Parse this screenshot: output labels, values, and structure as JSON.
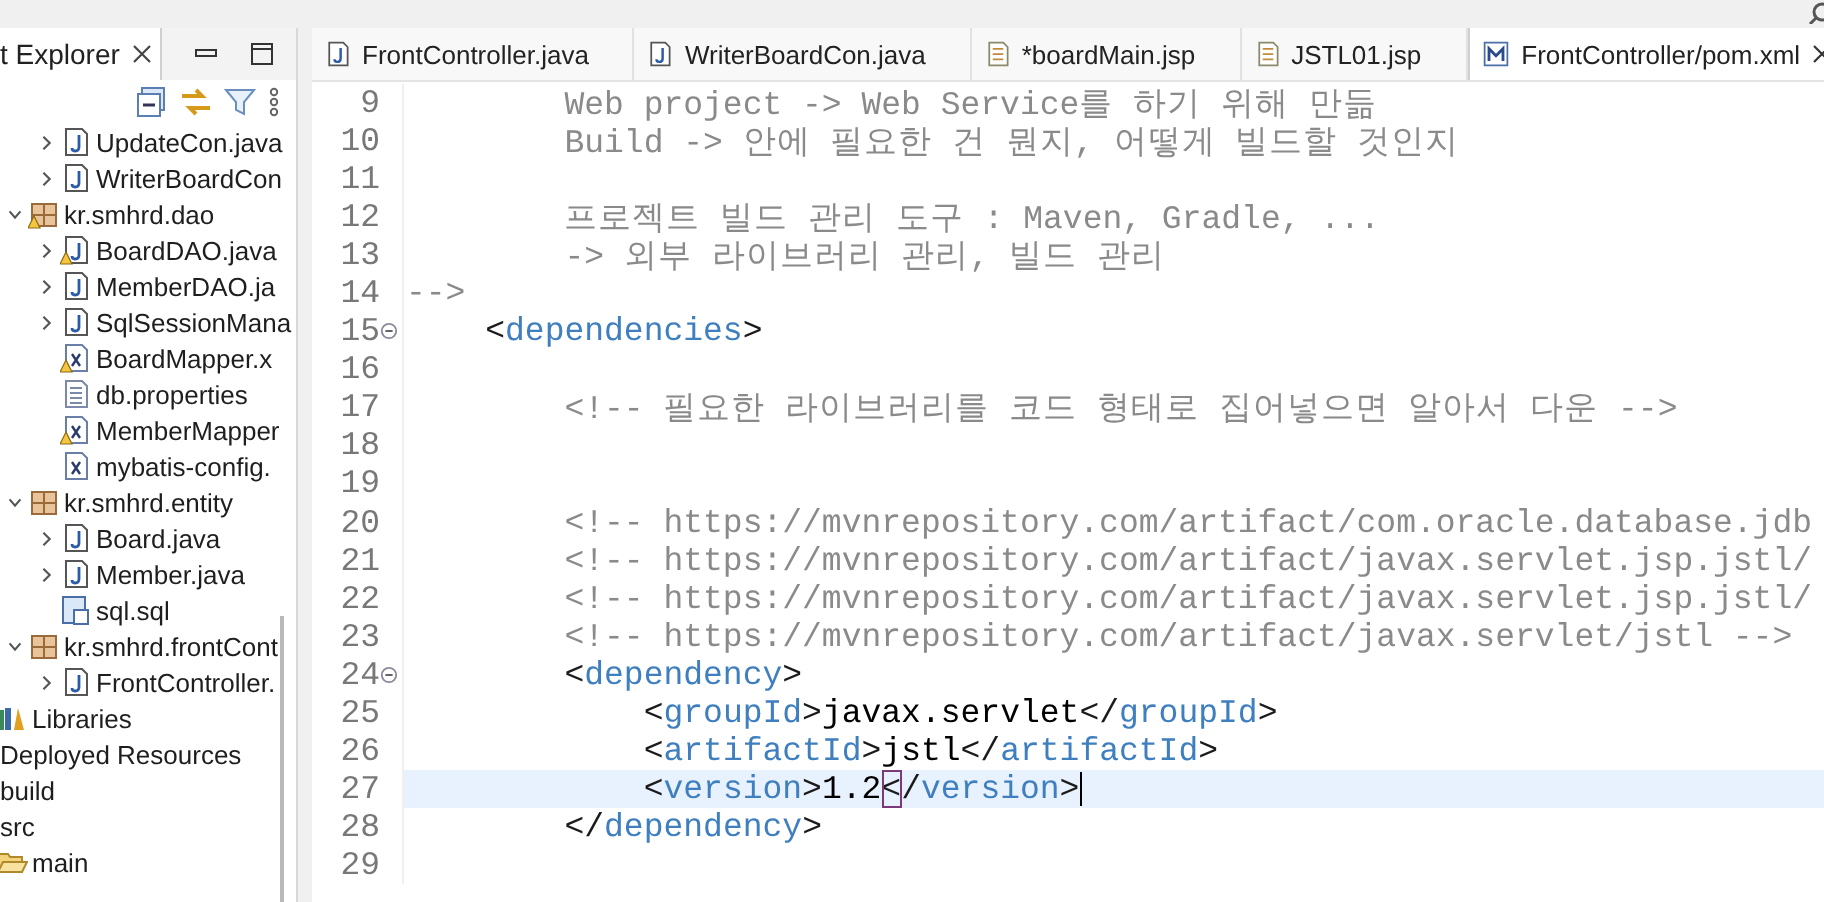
{
  "explorer": {
    "title": "t Explorer",
    "tree": [
      {
        "children": [
          {
            "children": [
              {
                "children": [
                  {
                    "children": [
                      {
                        "label": "UpdateCon.java",
                        "kind": "java",
                        "expanded": false
                      },
                      {
                        "label": "WriterBoardCon",
                        "kind": "java",
                        "expanded": false
                      }
                    ]
                  },
                  {
                    "label": "kr.smhrd.dao",
                    "kind": "package",
                    "expanded": true,
                    "warning": true,
                    "children": [
                      {
                        "label": "BoardDAO.java",
                        "kind": "java",
                        "expanded": false,
                        "warning": true
                      },
                      {
                        "label": "MemberDAO.ja",
                        "kind": "java",
                        "expanded": false
                      },
                      {
                        "label": "SqlSessionMana",
                        "kind": "java",
                        "expanded": false
                      },
                      {
                        "label": "BoardMapper.x",
                        "kind": "xml",
                        "warning": true
                      },
                      {
                        "label": "db.properties",
                        "kind": "properties"
                      },
                      {
                        "label": "MemberMapper",
                        "kind": "xml",
                        "warning": true
                      },
                      {
                        "label": "mybatis-config.",
                        "kind": "xml"
                      }
                    ]
                  },
                  {
                    "label": "kr.smhrd.entity",
                    "kind": "package",
                    "expanded": true,
                    "children": [
                      {
                        "label": "Board.java",
                        "kind": "java",
                        "expanded": false
                      },
                      {
                        "label": "Member.java",
                        "kind": "java",
                        "expanded": false
                      },
                      {
                        "label": "sql.sql",
                        "kind": "sql"
                      }
                    ]
                  },
                  {
                    "label": "kr.smhrd.frontCont",
                    "kind": "package",
                    "expanded": true,
                    "children": [
                      {
                        "label": "FrontController.",
                        "kind": "java",
                        "expanded": false
                      }
                    ]
                  }
                ]
              },
              {
                "label": "Libraries",
                "kind": "libraries"
              }
            ]
          },
          {
            "label": "Deployed Resources"
          },
          {
            "label": "build"
          },
          {
            "label": "src",
            "children": [
              {
                "label": "main",
                "kind": "folder-open"
              }
            ]
          }
        ]
      }
    ]
  },
  "tabs": [
    {
      "label": "FrontController.java",
      "kind": "java",
      "selected": false
    },
    {
      "label": "WriterBoardCon.java",
      "kind": "java",
      "selected": false
    },
    {
      "label": "*boardMain.jsp",
      "kind": "jsp",
      "selected": false
    },
    {
      "label": "JSTL01.jsp",
      "kind": "jsp",
      "selected": false
    },
    {
      "label": "FrontController/pom.xml",
      "kind": "maven",
      "selected": true
    }
  ],
  "lines": [
    {
      "number": "9",
      "tokens": [
        {
          "kind": "comment",
          "text": "        Web project -> Web Service를 하기 위해 만듦"
        }
      ]
    },
    {
      "number": "10",
      "tokens": [
        {
          "kind": "comment",
          "text": "        Build -> 안에 필요한 건 뭔지, 어떻게 빌드할 것인지"
        }
      ]
    },
    {
      "number": "11"
    },
    {
      "number": "12",
      "tokens": [
        {
          "kind": "comment",
          "text": "        프로젝트 빌드 관리 도구 : Maven, Gradle, ..."
        }
      ]
    },
    {
      "number": "13",
      "tokens": [
        {
          "kind": "comment",
          "text": "        -> 외부 라이브러리 관리, 빌드 관리"
        }
      ]
    },
    {
      "number": "14",
      "tokens": [
        {
          "kind": "comment",
          "text": "-->"
        }
      ]
    },
    {
      "number": "15",
      "fold": true,
      "tokens": [
        {
          "kind": "punct",
          "text": "    <"
        },
        {
          "kind": "tag",
          "text": "dependencies"
        },
        {
          "kind": "punct",
          "text": ">"
        }
      ]
    },
    {
      "number": "16"
    },
    {
      "number": "17",
      "tokens": [
        {
          "kind": "comment",
          "text": "        <!-- 필요한 라이브러리를 코드 형태로 집어넣으면 알아서 다운 -->"
        }
      ]
    },
    {
      "number": "18"
    },
    {
      "number": "19"
    },
    {
      "number": "20",
      "tokens": [
        {
          "kind": "comment",
          "text": "        <!-- https://mvnrepository.com/artifact/com.oracle.database.jdb"
        }
      ]
    },
    {
      "number": "21",
      "tokens": [
        {
          "kind": "comment",
          "text": "        <!-- https://mvnrepository.com/artifact/javax.servlet.jsp.jstl/"
        }
      ]
    },
    {
      "number": "22",
      "tokens": [
        {
          "kind": "comment",
          "text": "        <!-- https://mvnrepository.com/artifact/javax.servlet.jsp.jstl/"
        }
      ]
    },
    {
      "number": "23",
      "tokens": [
        {
          "kind": "comment",
          "text": "        <!-- https://mvnrepository.com/artifact/javax.servlet/jstl -->"
        }
      ]
    },
    {
      "number": "24",
      "fold": true,
      "tokens": [
        {
          "kind": "punct",
          "text": "        <"
        },
        {
          "kind": "tag",
          "text": "dependency"
        },
        {
          "kind": "punct",
          "text": ">"
        }
      ]
    },
    {
      "number": "25",
      "tokens": [
        {
          "kind": "punct",
          "text": "            <"
        },
        {
          "kind": "tag",
          "text": "groupId"
        },
        {
          "kind": "punct",
          "text": ">"
        },
        {
          "kind": "text",
          "text": "javax.servlet"
        },
        {
          "kind": "punct",
          "text": "</"
        },
        {
          "kind": "tag",
          "text": "groupId"
        },
        {
          "kind": "punct",
          "text": ">"
        }
      ]
    },
    {
      "number": "26",
      "tokens": [
        {
          "kind": "punct",
          "text": "            <"
        },
        {
          "kind": "tag",
          "text": "artifactId"
        },
        {
          "kind": "punct",
          "text": ">"
        },
        {
          "kind": "text",
          "text": "jstl"
        },
        {
          "kind": "punct",
          "text": "</"
        },
        {
          "kind": "tag",
          "text": "artifactId"
        },
        {
          "kind": "punct",
          "text": ">"
        }
      ]
    },
    {
      "number": "27",
      "current": true,
      "cursor": true,
      "tokens": [
        {
          "kind": "punct",
          "text": "            <"
        },
        {
          "kind": "tag",
          "text": "version"
        },
        {
          "kind": "punct",
          "text": ">"
        },
        {
          "kind": "text",
          "text": "1.2"
        },
        {
          "kind": "punct",
          "text": "<",
          "matched": true
        },
        {
          "kind": "punct",
          "text": "/"
        },
        {
          "kind": "tag",
          "text": "version"
        },
        {
          "kind": "punct",
          "text": ">"
        }
      ]
    },
    {
      "number": "28",
      "tokens": [
        {
          "kind": "punct",
          "text": "        </"
        },
        {
          "kind": "tag",
          "text": "dependency"
        },
        {
          "kind": "punct",
          "text": ">"
        }
      ]
    },
    {
      "number": "29"
    }
  ]
}
